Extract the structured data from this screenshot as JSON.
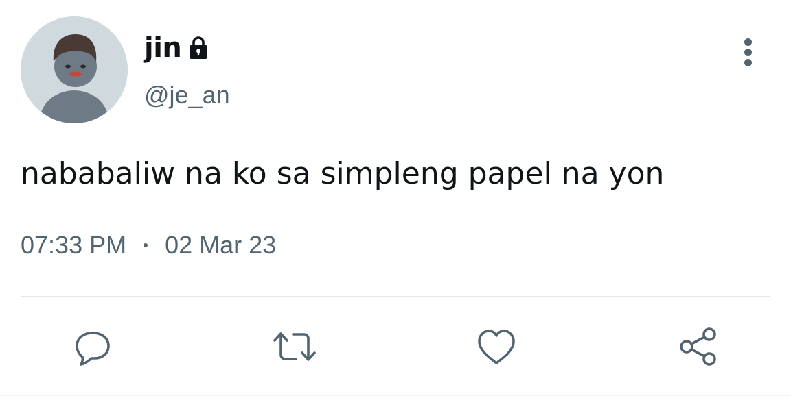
{
  "author": {
    "display_name": "jin",
    "handle": "@je_an",
    "avatar_icon": "default-profile-avatar",
    "protected_icon": "lock-icon"
  },
  "tweet": {
    "text": "nababaliw na ko sa simpleng papel na yon",
    "time": "07:33 PM",
    "date": "02 Mar 23"
  },
  "menu": {
    "more_icon": "more-vertical-icon"
  },
  "actions": {
    "reply_icon": "reply-icon",
    "retweet_icon": "retweet-icon",
    "like_icon": "heart-icon",
    "share_icon": "share-icon"
  },
  "colors": {
    "primary_text": "#0f1419",
    "secondary_text": "#536471",
    "divider": "#e1e8ed",
    "avatar_bg": "#cfd9de",
    "avatar_figure": "#6e7b86"
  }
}
